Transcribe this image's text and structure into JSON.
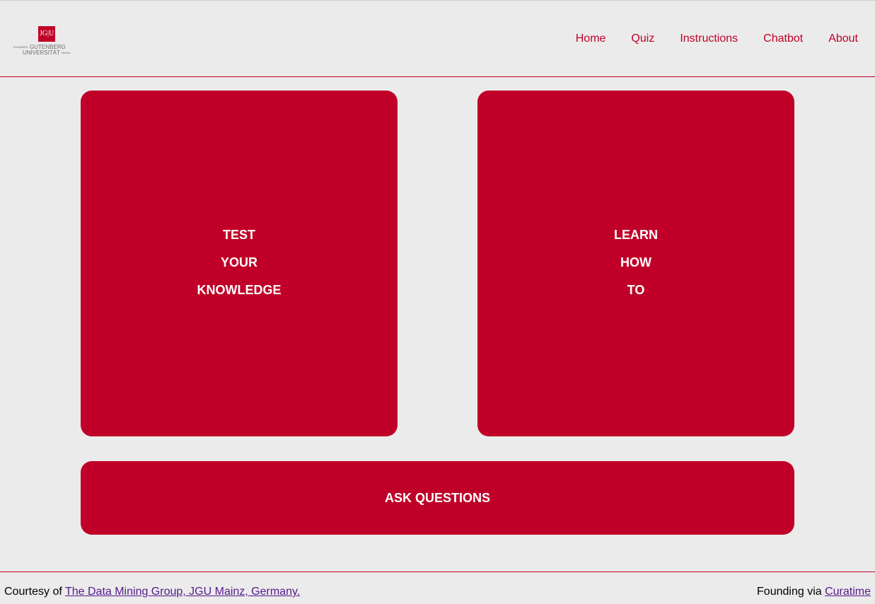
{
  "header": {
    "logo": {
      "mark": "JG|U",
      "line1_prefix": "JOHANNES",
      "line1_main": "GUTENBERG",
      "line2_main": "UNIVERSITÄT",
      "line2_suffix": "MAINZ"
    },
    "nav": [
      {
        "label": "Home"
      },
      {
        "label": "Quiz"
      },
      {
        "label": "Instructions"
      },
      {
        "label": "Chatbot"
      },
      {
        "label": "About"
      }
    ]
  },
  "main": {
    "test_card": {
      "lines": [
        "TEST",
        "YOUR",
        "KNOWLEDGE"
      ]
    },
    "learn_card": {
      "lines": [
        "LEARN",
        "HOW",
        "TO"
      ]
    },
    "ask_card": {
      "label": "ASK QUESTIONS"
    }
  },
  "footer": {
    "left_prefix": "Courtesy of ",
    "left_link": "The Data Mining Group, JGU Mainz, Germany.",
    "right_prefix": "Founding via ",
    "right_link": "Curatime"
  },
  "colors": {
    "brand_red": "#c00028",
    "background": "#ebebeb",
    "link_visited": "#551a8b"
  }
}
